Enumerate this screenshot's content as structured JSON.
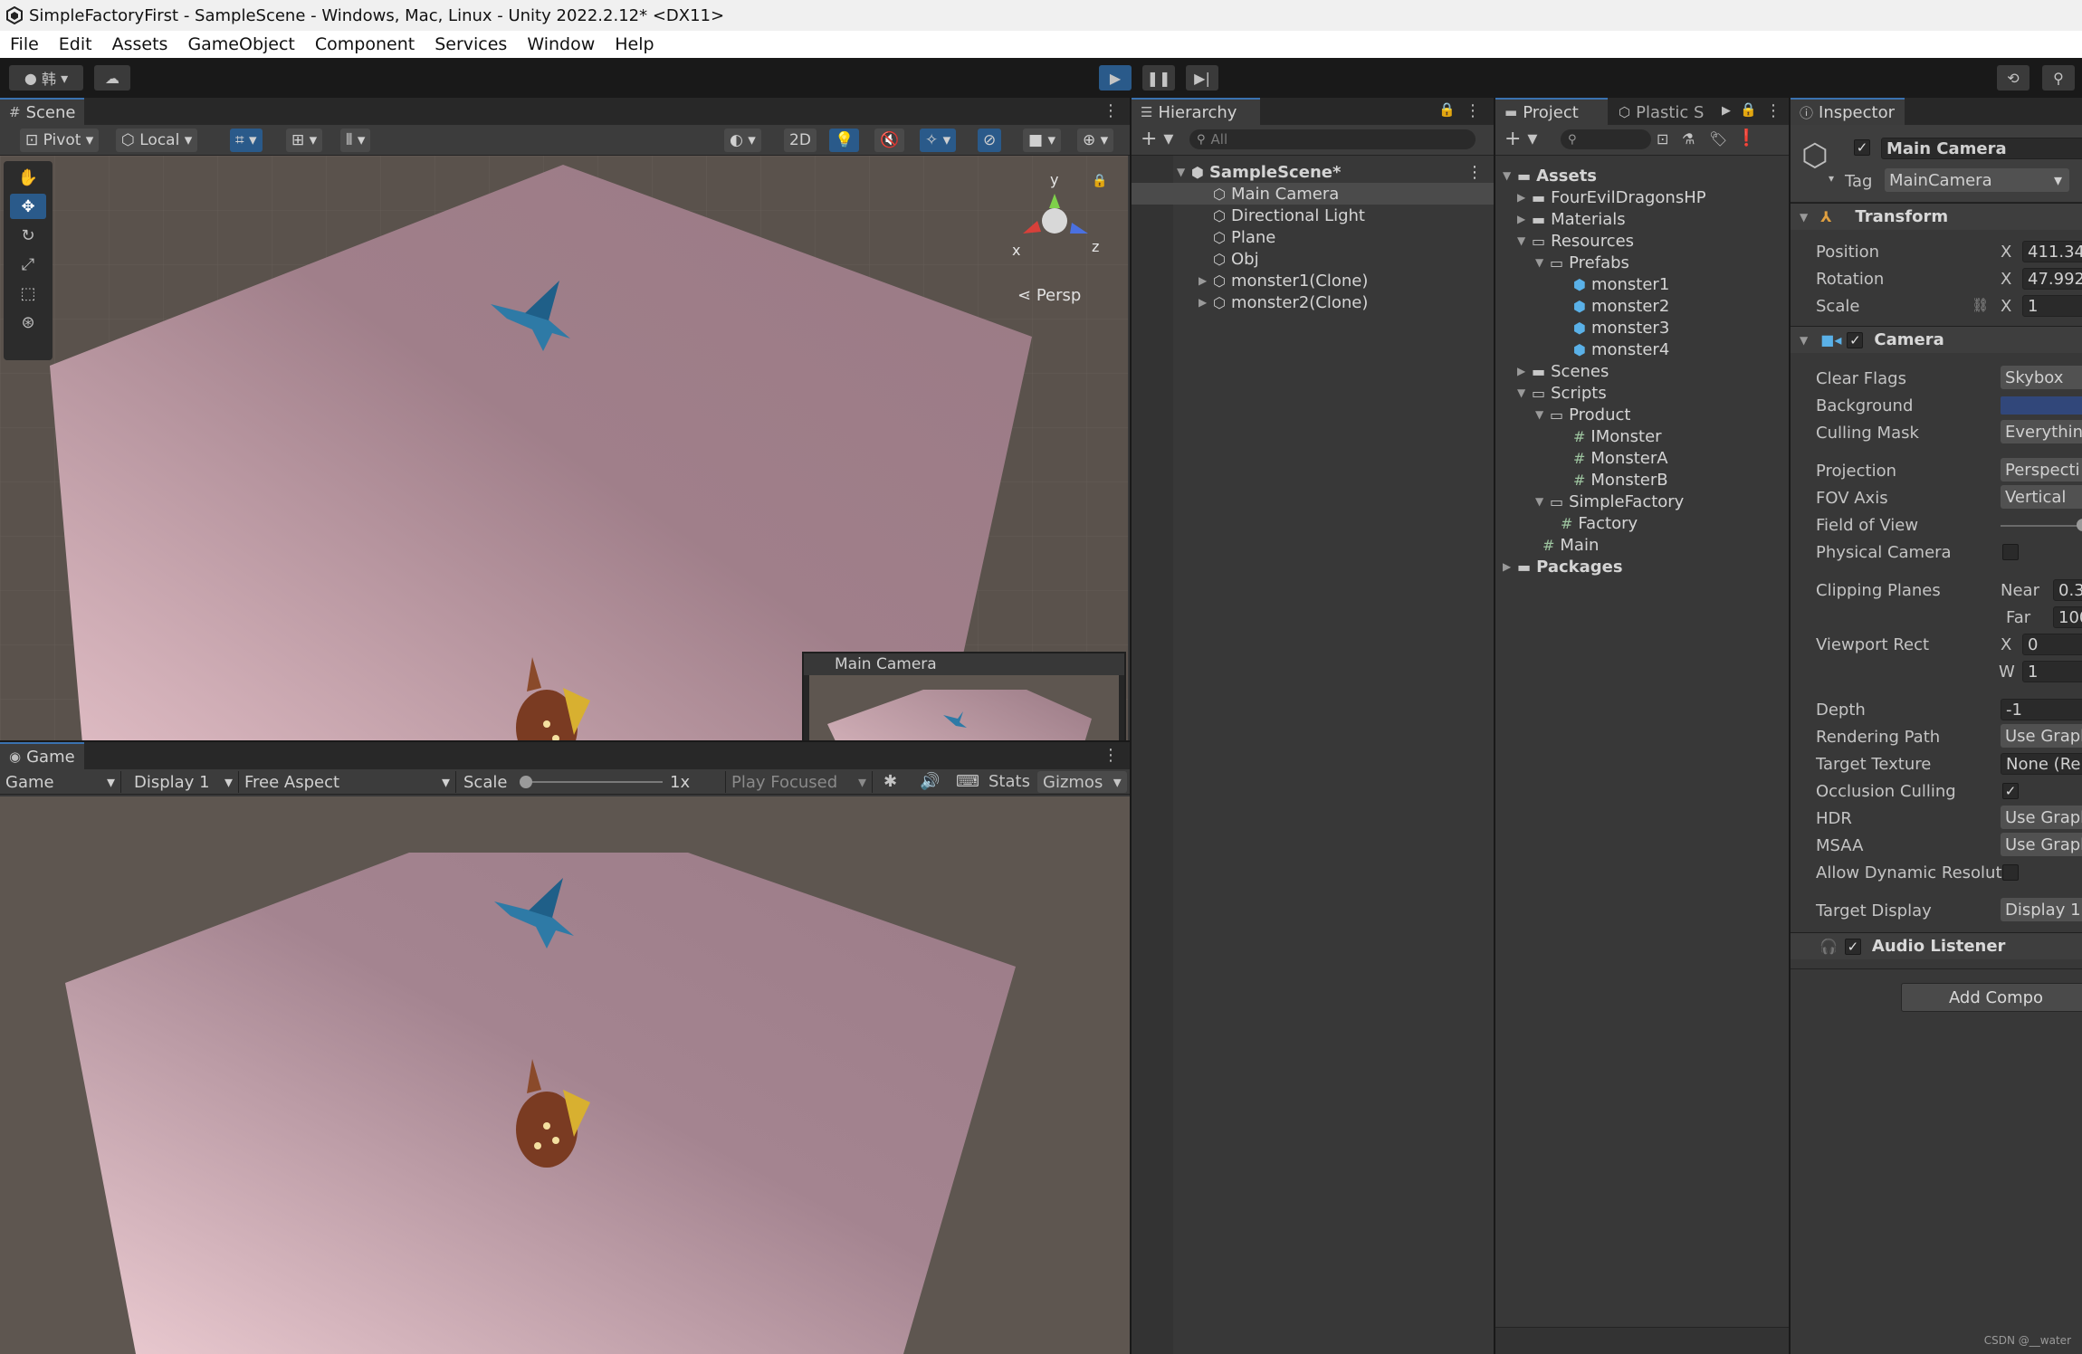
{
  "window": {
    "title": "SimpleFactoryFirst - SampleScene - Windows, Mac, Linux - Unity 2022.2.12* <DX11>"
  },
  "menu": [
    "File",
    "Edit",
    "Assets",
    "GameObject",
    "Component",
    "Services",
    "Window",
    "Help"
  ],
  "toolbar": {
    "account_label": "韩"
  },
  "scene": {
    "tab": "Scene",
    "pivot": "Pivot",
    "local": "Local",
    "mode_2d": "2D",
    "persp": "Persp",
    "gizmo_x": "x",
    "gizmo_y": "y",
    "gizmo_z": "z",
    "camera_preview_title": "Main Camera"
  },
  "game": {
    "tab": "Game",
    "view": "Game",
    "display": "Display 1",
    "aspect": "Free Aspect",
    "scale_label": "Scale",
    "scale_value": "1x",
    "play_focused": "Play Focused",
    "stats": "Stats",
    "gizmos": "Gizmos"
  },
  "hierarchy": {
    "tab": "Hierarchy",
    "search_placeholder": "All",
    "scene_name": "SampleScene*",
    "items": [
      "Main Camera",
      "Directional Light",
      "Plane",
      "Obj",
      "monster1(Clone)",
      "monster2(Clone)"
    ]
  },
  "project": {
    "tab": "Project",
    "tab2": "Plastic S",
    "tree": {
      "assets": "Assets",
      "four": "FourEvilDragonsHP",
      "materials": "Materials",
      "resources": "Resources",
      "prefabs": "Prefabs",
      "monsters": [
        "monster1",
        "monster2",
        "monster3",
        "monster4"
      ],
      "scenes": "Scenes",
      "scripts": "Scripts",
      "product": "Product",
      "product_scripts": [
        "IMonster",
        "MonsterA",
        "MonsterB"
      ],
      "simplefactory": "SimpleFactory",
      "factory": "Factory",
      "main": "Main",
      "packages": "Packages"
    }
  },
  "inspector": {
    "tab": "Inspector",
    "object_name": "Main Camera",
    "tag_label": "Tag",
    "tag_value": "MainCamera",
    "transform": {
      "header": "Transform",
      "position_label": "Position",
      "position_x": "411.34",
      "rotation_label": "Rotation",
      "rotation_x": "47.992",
      "scale_label": "Scale",
      "scale_x": "1",
      "x_label": "X"
    },
    "camera": {
      "header": "Camera",
      "fields": [
        {
          "label": "Clear Flags",
          "value": "Skybox"
        },
        {
          "label": "Background",
          "value": ""
        },
        {
          "label": "Culling Mask",
          "value": "Everythin"
        },
        {
          "label": "Projection",
          "value": "Perspecti"
        },
        {
          "label": "FOV Axis",
          "value": "Vertical"
        },
        {
          "label": "Field of View",
          "value": ""
        },
        {
          "label": "Physical Camera",
          "value": ""
        },
        {
          "label": "Clipping Planes",
          "value": ""
        },
        {
          "label": "Viewport Rect",
          "value": ""
        },
        {
          "label": "Depth",
          "value": "-1"
        },
        {
          "label": "Rendering Path",
          "value": "Use Grapl"
        },
        {
          "label": "Target Texture",
          "value": "None (Rer"
        },
        {
          "label": "Occlusion Culling",
          "value": ""
        },
        {
          "label": "HDR",
          "value": "Use Grapl"
        },
        {
          "label": "MSAA",
          "value": "Use Grapl"
        },
        {
          "label": "Allow Dynamic Resolut",
          "value": ""
        },
        {
          "label": "Target Display",
          "value": "Display 1"
        }
      ],
      "near_label": "Near",
      "near_value": "0.3",
      "far_label": "Far",
      "far_value": "100",
      "vr_x_label": "X",
      "vr_x_value": "0",
      "vr_w_label": "W",
      "vr_w_value": "1",
      "background_color": "#31477a"
    },
    "audio_listener": "Audio Listener",
    "add_component": "Add Compo"
  },
  "watermark": "CSDN @__water",
  "colors": {
    "accent": "#3a72b0",
    "play_active": "#2a5a8a",
    "plane": "#b8909c",
    "ground": "#5a524c"
  }
}
